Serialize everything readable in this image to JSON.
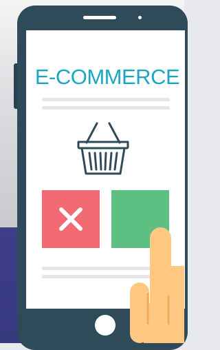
{
  "screen": {
    "title": "E-COMMERCE"
  },
  "icons": {
    "basket": "shopping-basket-icon",
    "reject": "x-mark-icon",
    "hand": "pointing-hand-icon"
  },
  "colors": {
    "phone_body": "#2f4a59",
    "title_text": "#1aa7c2",
    "reject_tile": "#f26a72",
    "accept_tile": "#5ebf82",
    "hand": "#fec883",
    "background_lower": "#3d3e86"
  }
}
